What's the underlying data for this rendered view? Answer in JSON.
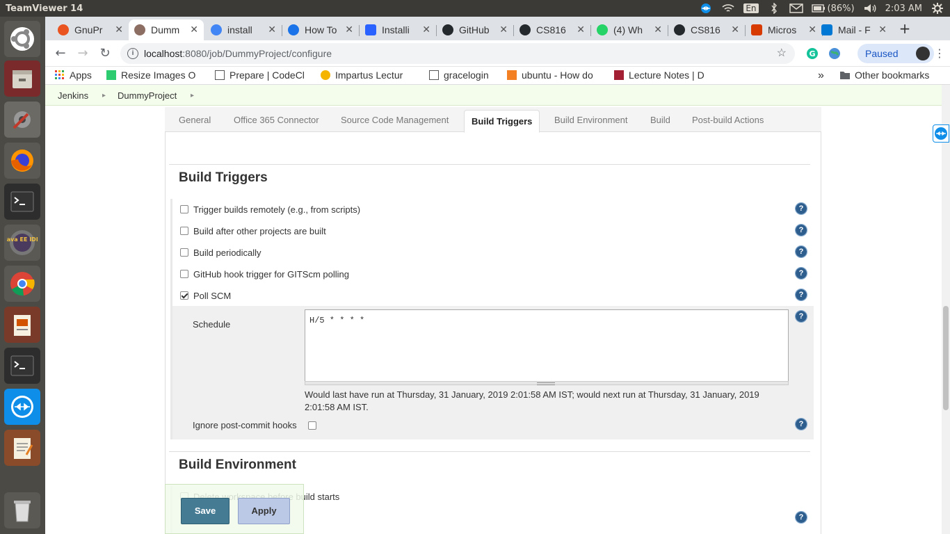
{
  "topbar": {
    "title": "TeamViewer 14",
    "lang": "En",
    "battery": "(86%)",
    "time": "2:03 AM"
  },
  "launcher": {
    "items": [
      "ubuntu-dash",
      "files",
      "system-settings",
      "firefox",
      "terminal",
      "eclipse-java-ee",
      "chrome",
      "impress",
      "terminal-2",
      "teamviewer",
      "text-editor",
      "trash"
    ],
    "eclipse_label": "Java EE IDE"
  },
  "tabs": [
    {
      "label": "GnuPr",
      "color": "#e95420"
    },
    {
      "label": "Dumm",
      "color": "#8d6e63"
    },
    {
      "label": "install",
      "color": "#4285f4"
    },
    {
      "label": "How To",
      "color": "#1a73e8"
    },
    {
      "label": "Installi",
      "color": "#2962ff"
    },
    {
      "label": "GitHub",
      "color": "#24292e"
    },
    {
      "label": "CS816",
      "color": "#24292e"
    },
    {
      "label": "(4) Wh",
      "color": "#25d366"
    },
    {
      "label": "CS816",
      "color": "#24292e"
    },
    {
      "label": "Micros",
      "color": "#d83b01"
    },
    {
      "label": "Mail - F",
      "color": "#0078d4"
    }
  ],
  "omnibar": {
    "host": "localhost",
    "path": ":8080/job/DummyProject/configure",
    "paused": "Paused"
  },
  "bookmarks": [
    {
      "label": "Apps",
      "color": "#ea4335"
    },
    {
      "label": "Resize Images O",
      "color": "#2ecc71"
    },
    {
      "label": "Prepare | CodeCl",
      "color": "#555555"
    },
    {
      "label": "Impartus Lectur",
      "color": "#f4b400"
    },
    {
      "label": "gracelogin",
      "color": "#555555"
    },
    {
      "label": "ubuntu - How do",
      "color": "#f48024"
    },
    {
      "label": "Lecture Notes | D",
      "color": "#a31f34"
    }
  ],
  "other_bookmarks": "Other bookmarks",
  "breadcrumb": [
    "Jenkins",
    "DummyProject"
  ],
  "section_tabs": [
    "General",
    "Office 365 Connector",
    "Source Code Management",
    "Build Triggers",
    "Build Environment",
    "Build",
    "Post-build Actions"
  ],
  "build_triggers": {
    "title": "Build Triggers",
    "options": [
      {
        "label": "Trigger builds remotely (e.g., from scripts)",
        "checked": false
      },
      {
        "label": "Build after other projects are built",
        "checked": false
      },
      {
        "label": "Build periodically",
        "checked": false
      },
      {
        "label": "GitHub hook trigger for GITScm polling",
        "checked": false
      },
      {
        "label": "Poll SCM",
        "checked": true
      }
    ],
    "schedule_label": "Schedule",
    "schedule_value": "H/5 * * * *",
    "schedule_note": "Would last have run at Thursday, 31 January, 2019 2:01:58 AM IST; would next run at Thursday, 31 January, 2019 2:01:58 AM IST.",
    "ignore_label": "Ignore post-commit hooks",
    "ignore_checked": false
  },
  "build_environment": {
    "title": "Build Environment",
    "options": [
      {
        "label": "Delete workspace before build starts",
        "checked": false
      }
    ]
  },
  "buttons": {
    "save": "Save",
    "apply": "Apply"
  },
  "help_glyph": "?"
}
